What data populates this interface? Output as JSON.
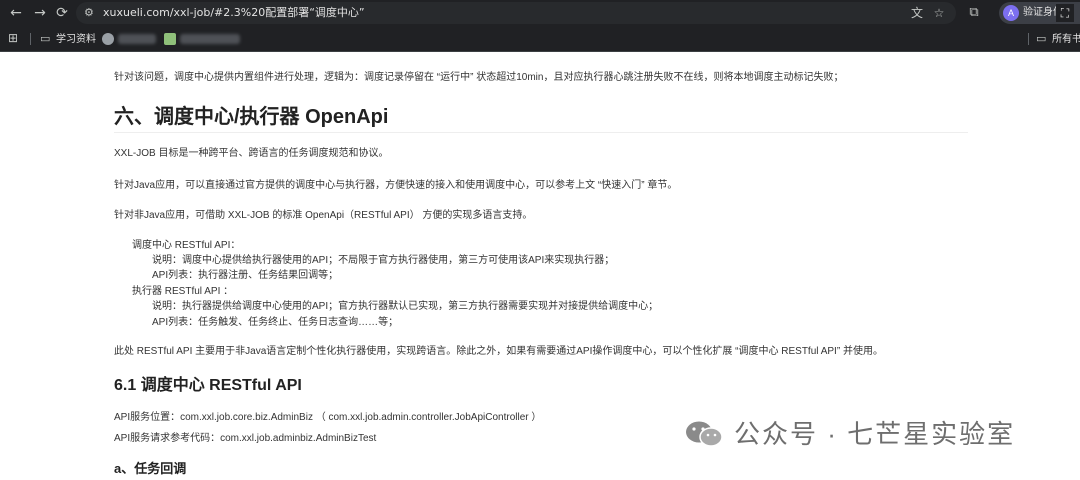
{
  "browser": {
    "url": "xuxueli.com/xxl-job/#2.3%20配置部署“调度中心”",
    "nav": {
      "back_icon": "←",
      "forward_icon": "→",
      "reload_icon": "⟳",
      "tune_icon": "⚙"
    },
    "omnibox_icons": {
      "translate_icon": "文",
      "star_icon": "☆"
    },
    "extensions_icon": "⧉",
    "profile": {
      "avatar_letter": "A",
      "label": "验证身份"
    },
    "screenshot_icon": "⛶",
    "bookmarks": {
      "apps_icon": "⊞",
      "folder_icon": "▭",
      "items": [
        {
          "label": "学习资料"
        }
      ],
      "all_bookmarks": "所有书签"
    }
  },
  "article": {
    "intro_line": "针对该问题，调度中心提供内置组件进行处理，逻辑为：调度记录停留在 “运行中” 状态超过10min，且对应执行器心跳注册失败不在线，则将本地调度主动标记失败；",
    "section_title": "六、调度中心/执行器 OpenApi",
    "p1": "XXL-JOB 目标是一种跨平台、跨语言的任务调度规范和协议。",
    "p2": "针对Java应用，可以直接通过官方提供的调度中心与执行器，方便快速的接入和使用调度中心，可以参考上文 “快速入门” 章节。",
    "p3": "针对非Java应用，可借助 XXL-JOB 的标准 OpenApi（RESTful API） 方便的实现多语言支持。",
    "list": [
      {
        "title": "调度中心 RESTful API：",
        "items": [
          "说明：调度中心提供给执行器使用的API；不局限于官方执行器使用，第三方可使用该API来实现执行器；",
          "API列表：执行器注册、任务结果回调等；"
        ]
      },
      {
        "title": "执行器 RESTful API ：",
        "items": [
          "说明：执行器提供给调度中心使用的API；官方执行器默认已实现，第三方执行器需要实现并对接提供给调度中心；",
          "API列表：任务触发、任务终止、任务日志查询……等；"
        ]
      }
    ],
    "p4": "此处 RESTful API 主要用于非Java语言定制个性化执行器使用，实现跨语言。除此之外，如果有需要通过API操作调度中心，可以个性化扩展 “调度中心 RESTful API” 并使用。",
    "subsection_title": "6.1 调度中心 RESTful API",
    "p5": "API服务位置：com.xxl.job.core.biz.AdminBiz （ com.xxl.job.admin.controller.JobApiController ）",
    "p6": "API服务请求参考代码：com.xxl.job.adminbiz.AdminBizTest",
    "sub_subsection_title": "a、任务回调"
  },
  "watermark": {
    "text": "公众号 · 七芒星实验室",
    "icon": "wechat-icon"
  },
  "colors": {
    "chrome_bg": "#202124",
    "omnibox_bg": "#282a2d",
    "profile_accent": "#7c6ff0",
    "text": "#333333",
    "heading": "#222222"
  }
}
